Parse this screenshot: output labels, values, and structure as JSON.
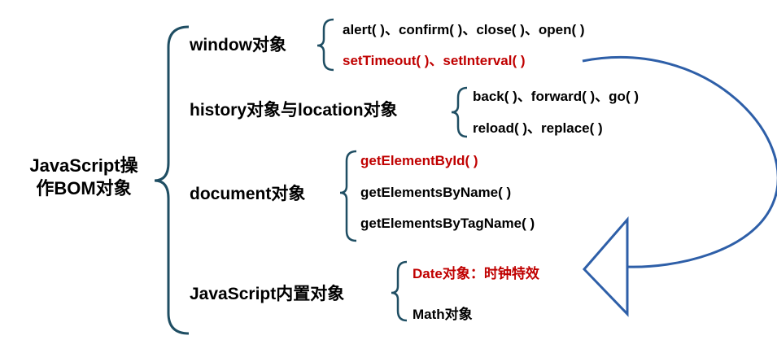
{
  "root": {
    "line1": "JavaScript操",
    "line2": "作BOM对象"
  },
  "nodes": {
    "window": {
      "label": "window对象",
      "items": [
        "alert( )、confirm( )、close( )、open( )",
        "setTimeout( )、setInterval( )"
      ]
    },
    "history_location": {
      "label": "history对象与location对象",
      "items": [
        "back( )、forward( )、go( )",
        "reload( )、replace( )"
      ]
    },
    "document": {
      "label": "document对象",
      "items": [
        "getElementById( )",
        "getElementsByName( )",
        "getElementsByTagName( )"
      ]
    },
    "builtin": {
      "label": "JavaScript内置对象",
      "items": [
        "Date对象：时钟特效",
        "Math对象"
      ]
    }
  },
  "colors": {
    "brace": "#1f4e63",
    "accent_text": "#c00000",
    "arrow": "#2e5fa8"
  }
}
